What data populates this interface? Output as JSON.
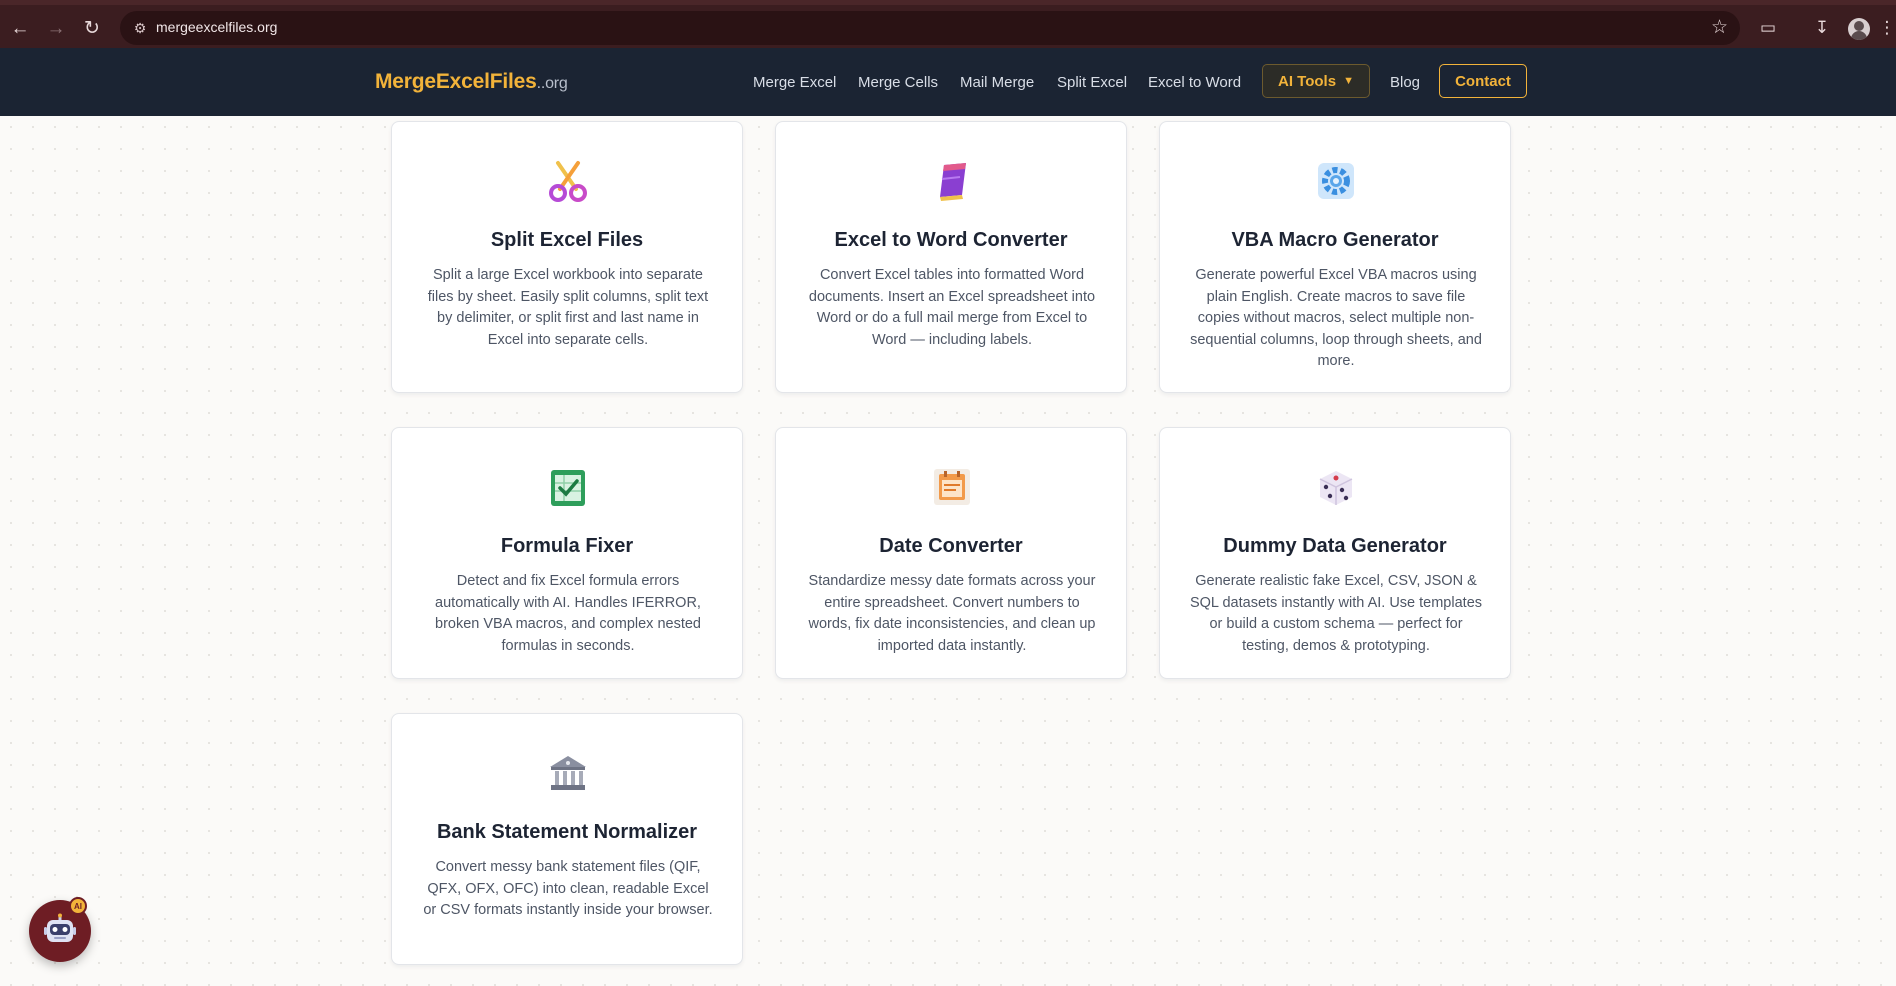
{
  "browser": {
    "url": "mergeexcelfiles.org"
  },
  "header": {
    "logo_main": "MergeExcelFiles",
    "logo_tld": "..org",
    "nav": [
      {
        "label": "Merge Excel"
      },
      {
        "label": "Merge Cells"
      },
      {
        "label": "Mail Merge"
      },
      {
        "label": "Split Excel"
      },
      {
        "label": "Excel to Word"
      }
    ],
    "ai_tools_label": "AI Tools",
    "blog_label": "Blog",
    "contact_label": "Contact"
  },
  "cards": [
    {
      "icon": "scissors-icon",
      "title": "Split Excel Files",
      "desc": "Split a large Excel workbook into separate files by sheet. Easily split columns, split text by delimiter, or split first and last name in Excel into separate cells."
    },
    {
      "icon": "book-icon",
      "title": "Excel to Word Converter",
      "desc": "Convert Excel tables into formatted Word documents. Insert an Excel spreadsheet into Word or do a full mail merge from Excel to Word — including labels."
    },
    {
      "icon": "gear-icon",
      "title": "VBA Macro Generator",
      "desc": "Generate powerful Excel VBA macros using plain English. Create macros to save file copies without macros, select multiple non-sequential columns, loop through sheets, and more."
    },
    {
      "icon": "spreadsheet-check-icon",
      "title": "Formula Fixer",
      "desc": "Detect and fix Excel formula errors automatically with AI. Handles IFERROR, broken VBA macros, and complex nested formulas in seconds."
    },
    {
      "icon": "calendar-icon",
      "title": "Date Converter",
      "desc": "Standardize messy date formats across your entire spreadsheet. Convert numbers to words, fix date inconsistencies, and clean up imported data instantly."
    },
    {
      "icon": "dice-icon",
      "title": "Dummy Data Generator",
      "desc": "Generate realistic fake Excel, CSV, JSON & SQL datasets instantly with AI. Use templates or build a custom schema — perfect for testing, demos & prototyping."
    },
    {
      "icon": "bank-icon",
      "title": "Bank Statement Normalizer",
      "desc": "Convert messy bank statement files (QIF, QFX, OFX, OFC) into clean, readable Excel or CSV formats instantly inside your browser."
    }
  ],
  "chat": {
    "badge": "AI"
  },
  "colors": {
    "accent": "#f2b33a",
    "header_bg": "#1b2433",
    "browser_bg": "#3b1d20"
  }
}
